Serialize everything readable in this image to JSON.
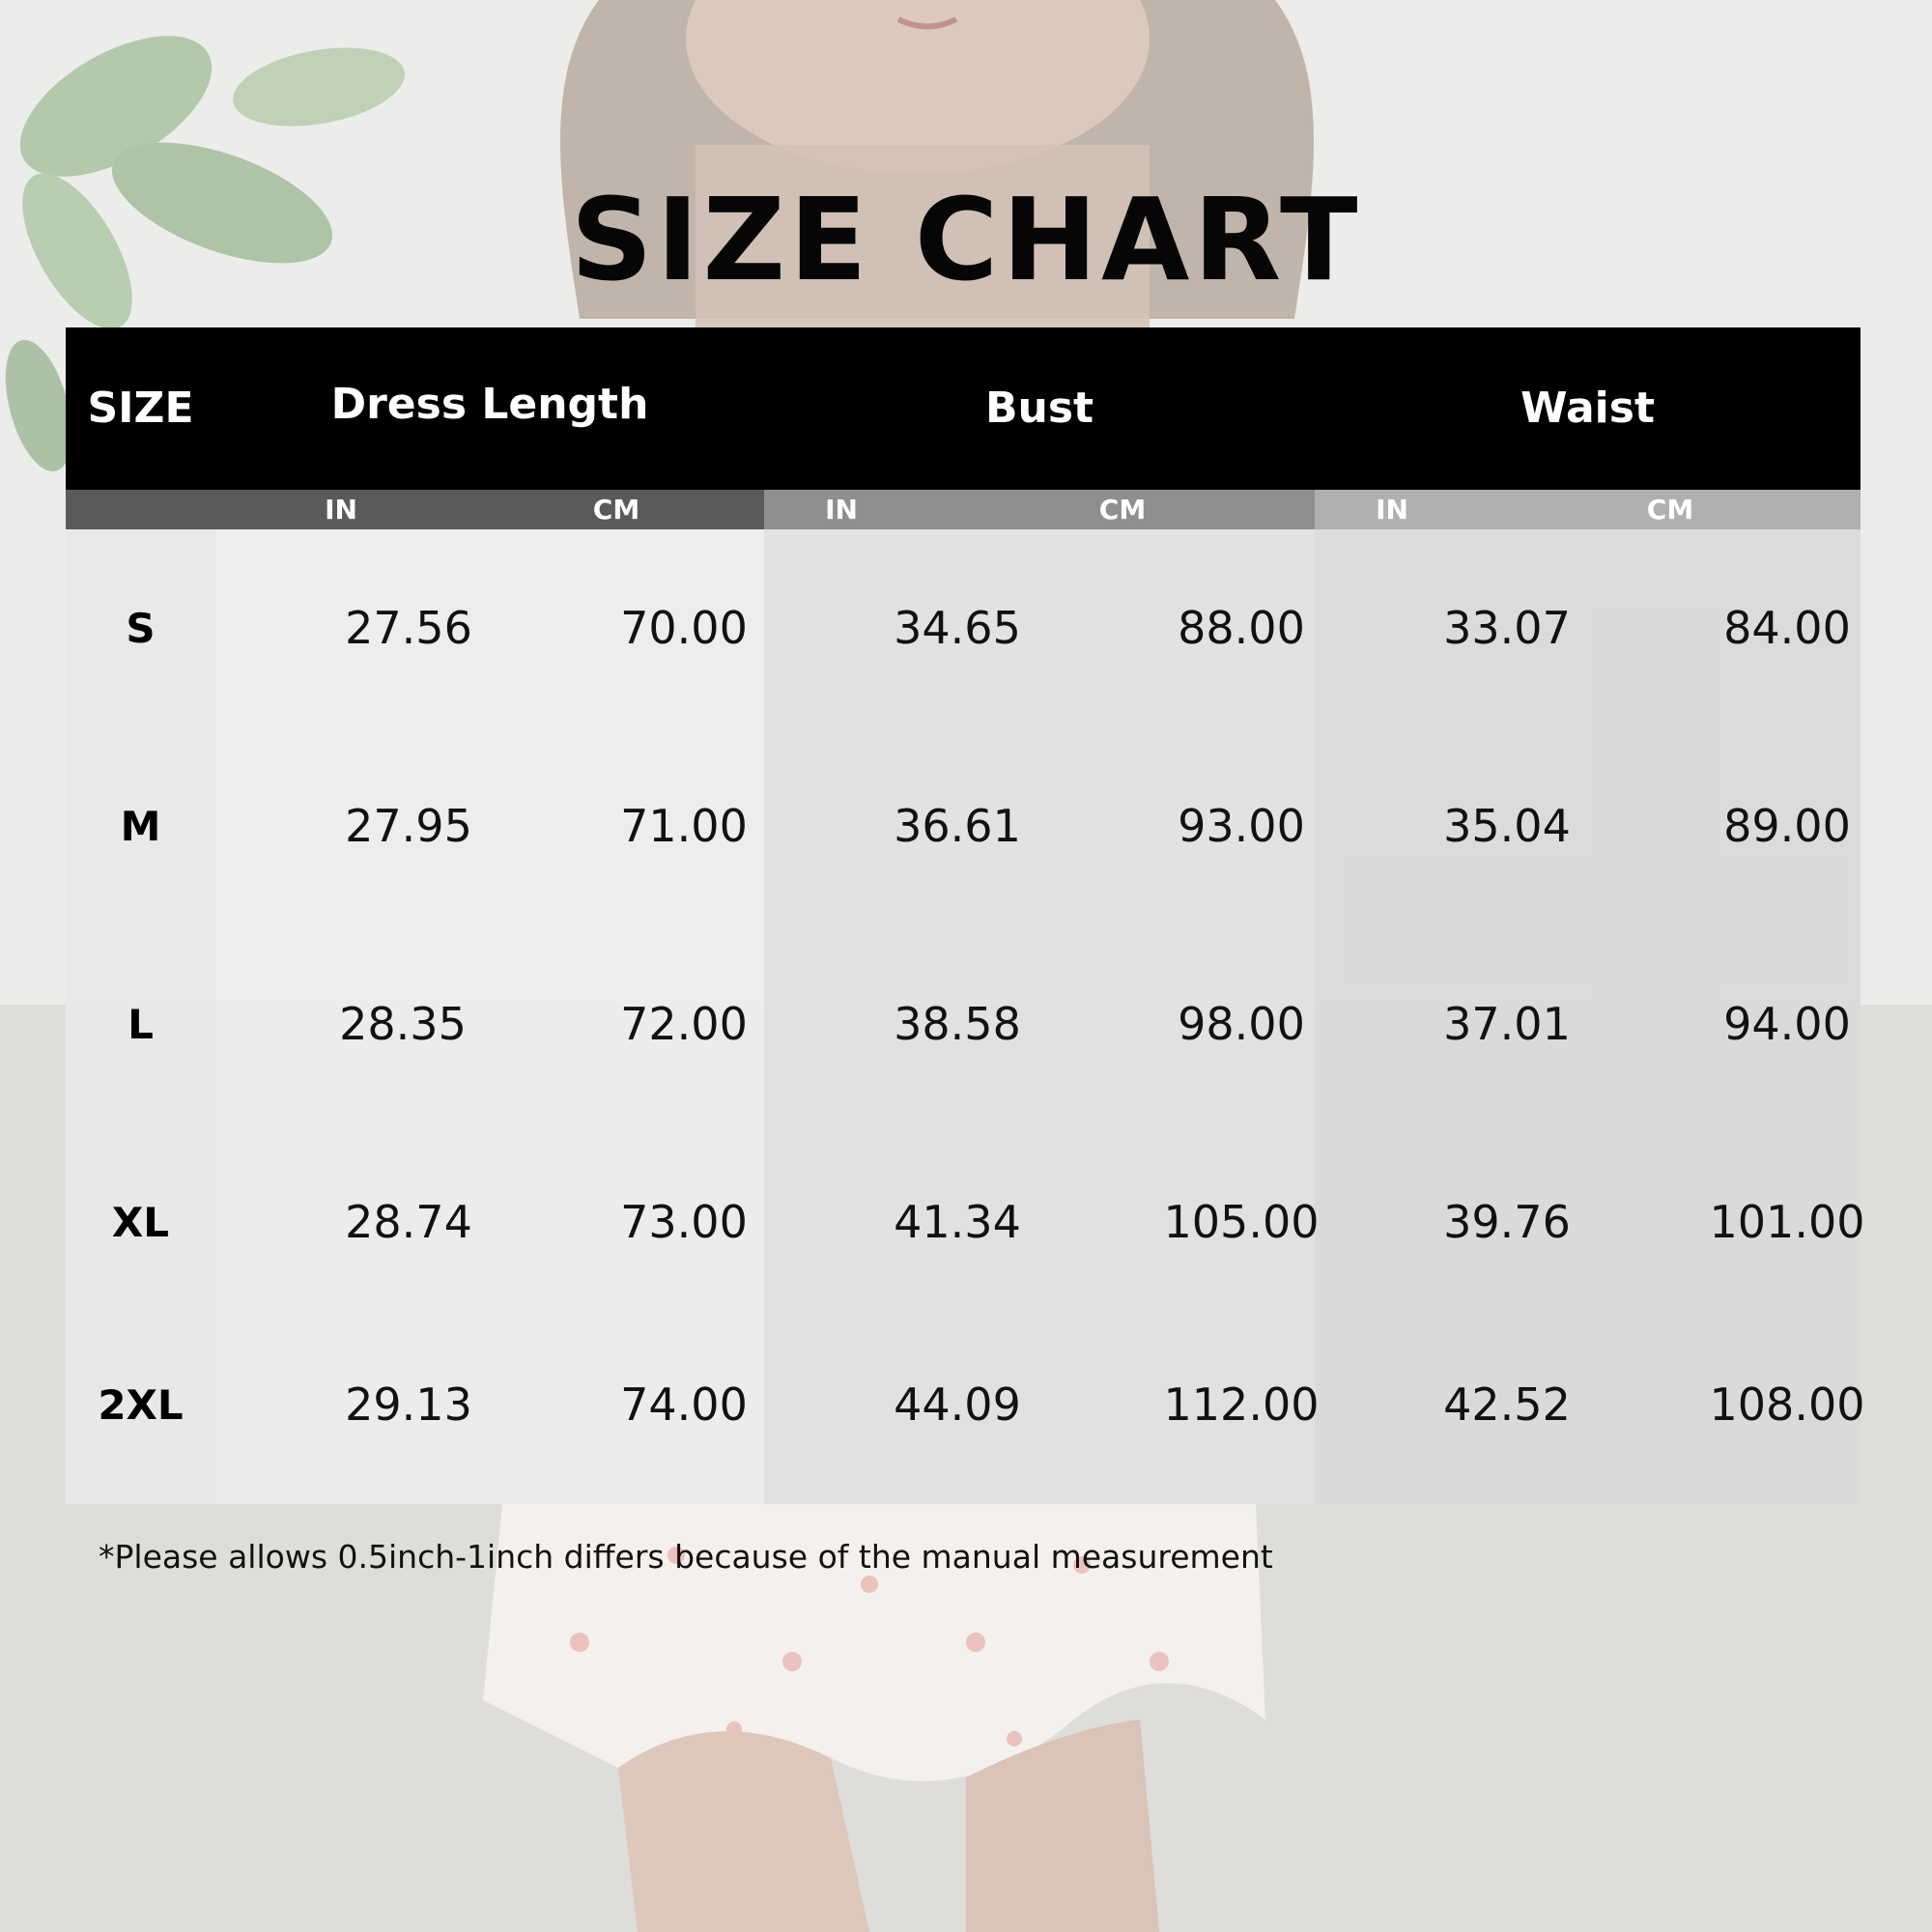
{
  "title": "SIZE CHART",
  "header": {
    "size": "SIZE",
    "groups": [
      "Dress Length",
      "Bust",
      "Waist"
    ]
  },
  "units": [
    "IN",
    "CM",
    "IN",
    "CM",
    "IN",
    "CM"
  ],
  "rows": [
    {
      "size": "S",
      "values": [
        "27.56",
        "70.00",
        "34.65",
        "88.00",
        "33.07",
        "84.00"
      ]
    },
    {
      "size": "M",
      "values": [
        "27.95",
        "71.00",
        "36.61",
        "93.00",
        "35.04",
        "89.00"
      ]
    },
    {
      "size": "L",
      "values": [
        "28.35",
        "72.00",
        "38.58",
        "98.00",
        "37.01",
        "94.00"
      ]
    },
    {
      "size": "XL",
      "values": [
        "28.74",
        "73.00",
        "41.34",
        "105.00",
        "39.76",
        "101.00"
      ]
    },
    {
      "size": "2XL",
      "values": [
        "29.13",
        "74.00",
        "44.09",
        "112.00",
        "42.52",
        "108.00"
      ]
    }
  ],
  "note": "*Please allows 0.5inch-1inch differs because of the manual measurement",
  "colors": {
    "header_bg": "#000000",
    "sub_dress": "#5a5a5a",
    "sub_bust": "#8f8f8f",
    "sub_waist": "#b0b0b0",
    "body_size": "#e9e9e9",
    "body_dress": "#ececec",
    "body_bust": "#e0e0e0",
    "body_waist": "#d9d9d9"
  }
}
